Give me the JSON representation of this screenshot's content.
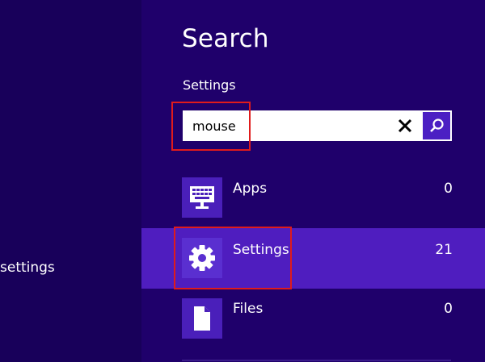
{
  "left": {
    "text": "settings"
  },
  "charm": {
    "title": "Search",
    "scope_label": "Settings",
    "search": {
      "value": "mouse",
      "placeholder": ""
    },
    "results": [
      {
        "label": "Apps",
        "count": "0",
        "icon": "monitor-keyboard-icon",
        "selected": false
      },
      {
        "label": "Settings",
        "count": "21",
        "icon": "gear-icon",
        "selected": true
      },
      {
        "label": "Files",
        "count": "0",
        "icon": "document-icon",
        "selected": false
      }
    ]
  },
  "colors": {
    "background": "#18005a",
    "charm_background": "#1f006b",
    "selected_row": "#4f1dbf",
    "icon_tile": "#4a1fba",
    "search_button": "#4b1fc3",
    "highlight": "#e01b1b"
  }
}
